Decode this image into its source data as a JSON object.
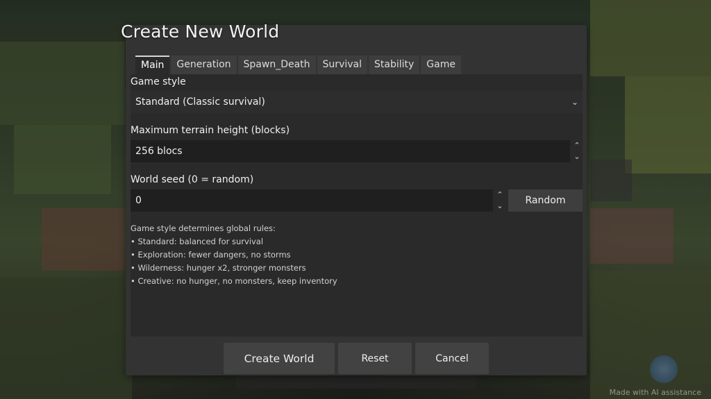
{
  "dialog": {
    "title": "Create New World"
  },
  "tabs": [
    {
      "label": "Main",
      "active": true
    },
    {
      "label": "Generation",
      "active": false
    },
    {
      "label": "Spawn_Death",
      "active": false
    },
    {
      "label": "Survival",
      "active": false
    },
    {
      "label": "Stability",
      "active": false
    },
    {
      "label": "Game",
      "active": false
    }
  ],
  "main": {
    "game_style": {
      "label": "Game style",
      "value": "Standard (Classic survival)"
    },
    "terrain_height": {
      "label": "Maximum terrain height (blocks)",
      "value": "256  blocs"
    },
    "seed": {
      "label": "World seed (0 = random)",
      "value": "0",
      "random_button": "Random"
    },
    "help": {
      "intro": "Game style determines global rules:",
      "lines": [
        "• Standard: balanced for survival",
        "• Exploration: fewer dangers, no storms",
        "• Wilderness: hunger x2, stronger monsters",
        "• Creative: no hunger, no monsters, keep inventory"
      ]
    }
  },
  "footer": {
    "create": "Create World",
    "reset": "Reset",
    "cancel": "Cancel"
  },
  "watermark": "Made with AI assistance",
  "icons": {
    "select": "chevron-down-icon",
    "spin_up": "chevron-up-icon",
    "spin_down": "chevron-down-icon"
  }
}
